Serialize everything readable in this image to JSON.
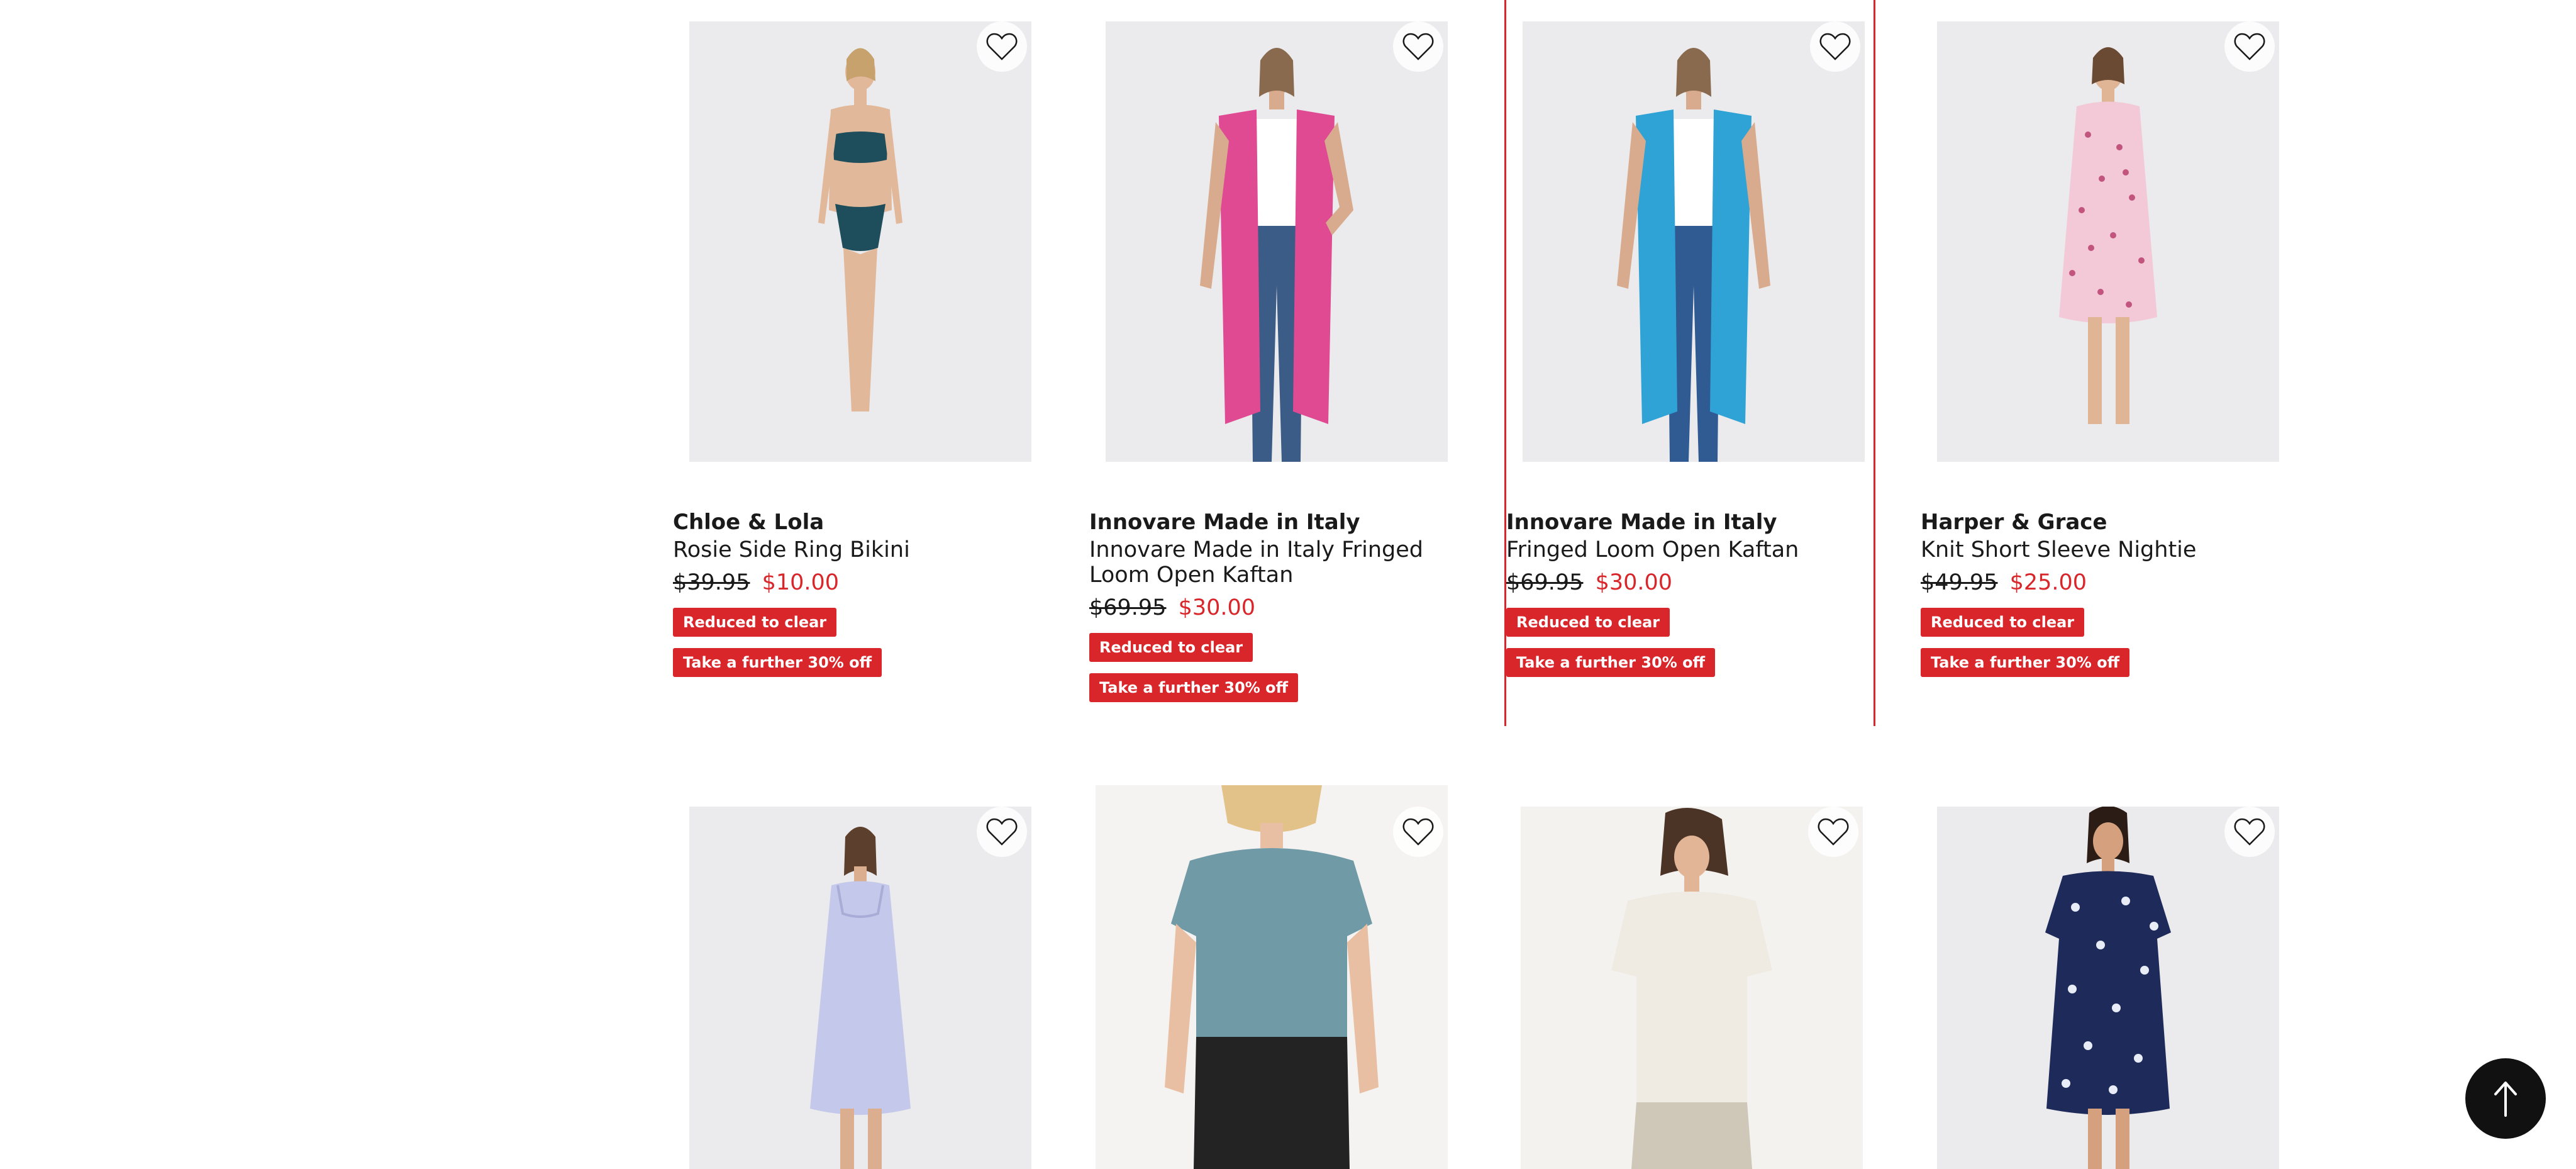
{
  "products": [
    {
      "brand": "Chloe & Lola",
      "name": "Rosie Side Ring Bikini",
      "was_price": "$39.95",
      "now_price": "$10.00",
      "badge_1": "Reduced to clear",
      "badge_2": "Take a further 30% off"
    },
    {
      "brand": "Innovare Made in Italy",
      "name": "Innovare Made in Italy Fringed Loom Open Kaftan",
      "was_price": "$69.95",
      "now_price": "$30.00",
      "badge_1": "Reduced to clear",
      "badge_2": "Take a further 30% off"
    },
    {
      "brand": "Innovare Made in Italy",
      "name": "Fringed Loom Open Kaftan",
      "was_price": "$69.95",
      "now_price": "$30.00",
      "badge_1": "Reduced to clear",
      "badge_2": "Take a further 30% off"
    },
    {
      "brand": "Harper & Grace",
      "name": "Knit Short Sleeve Nightie",
      "was_price": "$49.95",
      "now_price": "$25.00",
      "badge_1": "Reduced to clear",
      "badge_2": "Take a further 30% off"
    }
  ],
  "icons": {
    "favourite": "heart-outline-icon",
    "back_to_top": "arrow-up-icon"
  },
  "colors": {
    "accent": "#d9262b",
    "back_to_top_bg": "#111111"
  }
}
